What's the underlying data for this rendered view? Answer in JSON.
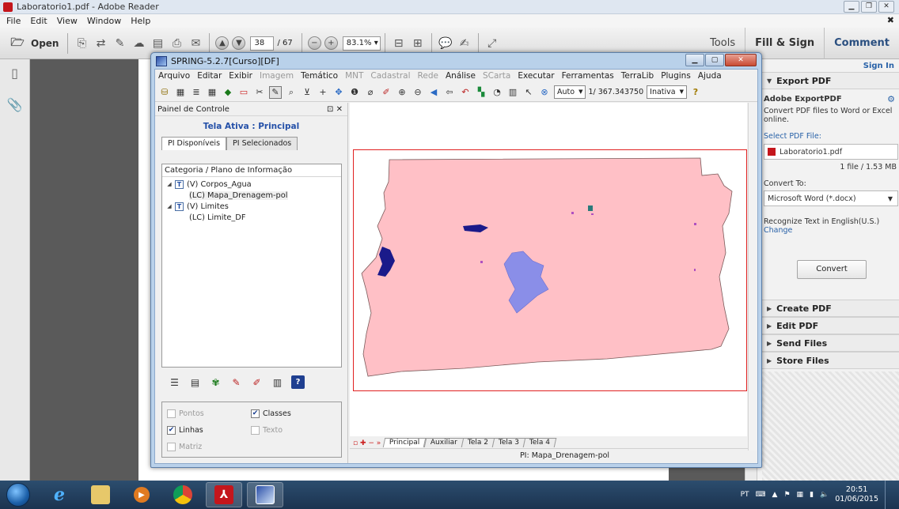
{
  "reader": {
    "title": "Laboratorio1.pdf - Adobe Reader",
    "menu": [
      "File",
      "Edit",
      "View",
      "Window",
      "Help"
    ],
    "toolbar": {
      "open_label": "Open",
      "page_current": "38",
      "page_total": "/ 67",
      "zoom": "83.1%",
      "tools_label": "Tools",
      "fill_sign_label": "Fill & Sign",
      "comment_label": "Comment"
    },
    "right_panel": {
      "sign_in": "Sign In",
      "export_pdf": "Export PDF",
      "adobe_export_title": "Adobe ExportPDF",
      "adobe_export_desc_1": "Convert PDF files to Word or Excel",
      "adobe_export_desc_2": "online.",
      "select_file_label": "Select PDF File:",
      "file_name": "Laboratorio1.pdf",
      "file_info": "1 file / 1.53 MB",
      "convert_to_label": "Convert To:",
      "convert_format": "Microsoft Word (*.docx)",
      "recognize_text": "Recognize Text in English(U.S.)",
      "change_link": "Change",
      "convert_button": "Convert",
      "sections": [
        "Create PDF",
        "Edit PDF",
        "Send Files",
        "Store Files"
      ]
    }
  },
  "spring": {
    "title": "SPRING-5.2.7[Curso][DF]",
    "menu": [
      {
        "label": "Arquivo",
        "enabled": true
      },
      {
        "label": "Editar",
        "enabled": true
      },
      {
        "label": "Exibir",
        "enabled": true
      },
      {
        "label": "Imagem",
        "enabled": false
      },
      {
        "label": "Temático",
        "enabled": true
      },
      {
        "label": "MNT",
        "enabled": false
      },
      {
        "label": "Cadastral",
        "enabled": false
      },
      {
        "label": "Rede",
        "enabled": false
      },
      {
        "label": "Análise",
        "enabled": true
      },
      {
        "label": "SCarta",
        "enabled": false
      },
      {
        "label": "Executar",
        "enabled": true
      },
      {
        "label": "Ferramentas",
        "enabled": true
      },
      {
        "label": "TerraLib",
        "enabled": true
      },
      {
        "label": "Plugins",
        "enabled": true
      },
      {
        "label": "Ajuda",
        "enabled": true
      }
    ],
    "toolbar": {
      "scale_mode": "Auto",
      "scale_value": "1/ 367.343750",
      "state": "Inativa"
    },
    "panel": {
      "title": "Painel de Controle",
      "active_screen": "Tela Ativa : Principal",
      "tab_available": "PI Disponíveis",
      "tab_selected": "PI Selecionados",
      "tree_header": "Categoria / Plano de Informação",
      "tree": [
        {
          "category": "(V) Corpos_Agua",
          "plans": [
            "(LC) Mapa_Drenagem-pol"
          ]
        },
        {
          "category": "(V) Limites",
          "plans": [
            "(LC) Limite_DF"
          ]
        }
      ],
      "checks": {
        "pontos": "Pontos",
        "classes": "Classes",
        "linhas": "Linhas",
        "texto": "Texto",
        "matriz": "Matriz"
      }
    },
    "screens": [
      "Principal",
      "Auxiliar",
      "Tela 2",
      "Tela 3",
      "Tela 4"
    ],
    "status": "PI: Mapa_Drenagem-pol",
    "map_colors": {
      "fill": "#ffc0c6",
      "outline": "#7a5a5a",
      "lake": "#8a8ee8",
      "water_dark": "#1a1a8a",
      "frame": "#e02020"
    }
  },
  "taskbar": {
    "lang": "PT",
    "time": "20:51",
    "date": "01/06/2015"
  }
}
